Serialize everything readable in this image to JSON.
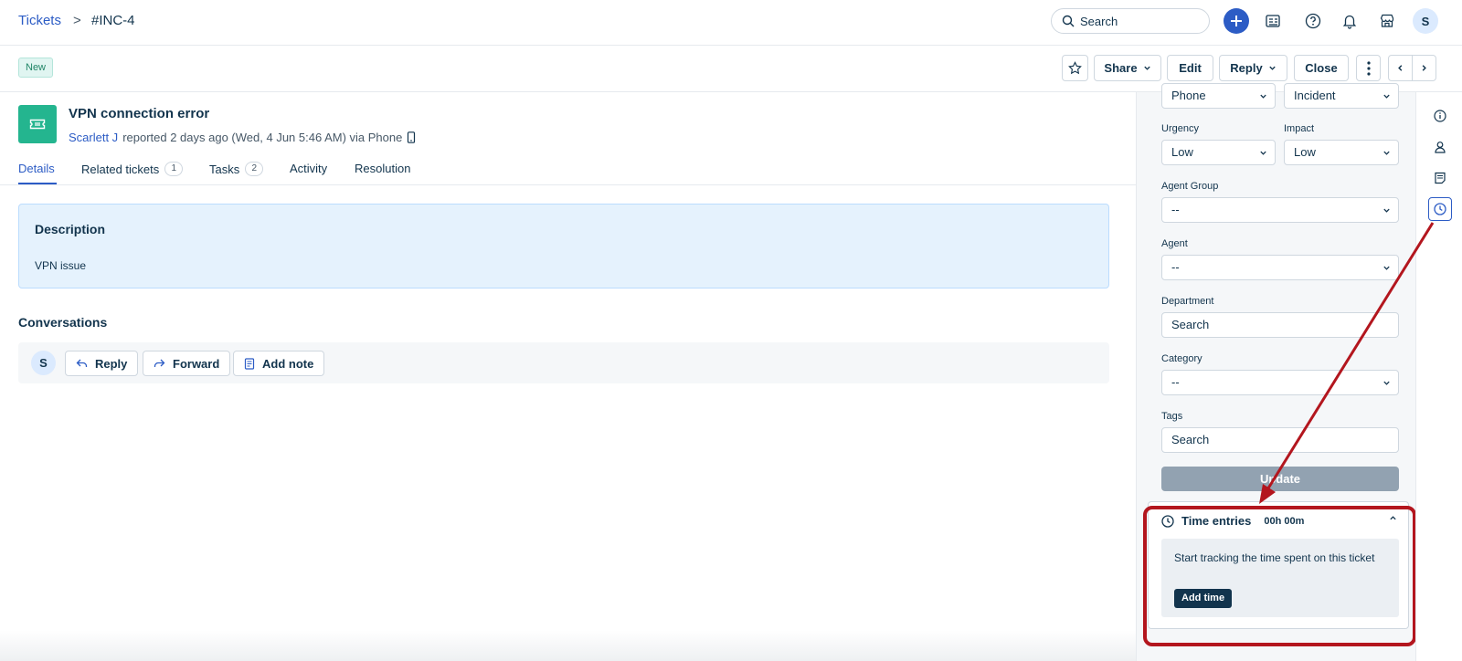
{
  "breadcrumb": {
    "root": "Tickets",
    "separator": ">",
    "current": "#INC-4"
  },
  "search": {
    "placeholder": "Search"
  },
  "user_initial": "S",
  "status_badge": "New",
  "actions": {
    "share": "Share",
    "edit": "Edit",
    "reply": "Reply",
    "close": "Close"
  },
  "ticket": {
    "title": "VPN connection error",
    "reporter": "Scarlett J",
    "reported_text": "reported 2 days ago (Wed, 4 Jun 5:46 AM) via Phone"
  },
  "tabs": [
    {
      "label": "Details"
    },
    {
      "label": "Related tickets",
      "count": "1"
    },
    {
      "label": "Tasks",
      "count": "2"
    },
    {
      "label": "Activity"
    },
    {
      "label": "Resolution"
    }
  ],
  "description": {
    "heading": "Description",
    "body": "VPN issue"
  },
  "conversations": {
    "title": "Conversations",
    "avatar": "S",
    "reply": "Reply",
    "forward": "Forward",
    "add_note": "Add note"
  },
  "properties": {
    "source_value": "Phone",
    "type_value": "Incident",
    "urgency": {
      "label": "Urgency",
      "value": "Low"
    },
    "impact": {
      "label": "Impact",
      "value": "Low"
    },
    "agent_group": {
      "label": "Agent Group",
      "value": "--"
    },
    "agent": {
      "label": "Agent",
      "value": "--"
    },
    "department": {
      "label": "Department",
      "placeholder": "Search"
    },
    "category": {
      "label": "Category",
      "value": "--"
    },
    "tags": {
      "label": "Tags",
      "placeholder": "Search"
    },
    "update": "Update"
  },
  "time_entries": {
    "title": "Time entries",
    "duration": "00h 00m",
    "message": "Start tracking the time spent on this ticket",
    "add_time": "Add time"
  },
  "colors": {
    "accent": "#2c5cc5",
    "highlight": "#b3161e",
    "ticket_icon": "#24b58f"
  }
}
